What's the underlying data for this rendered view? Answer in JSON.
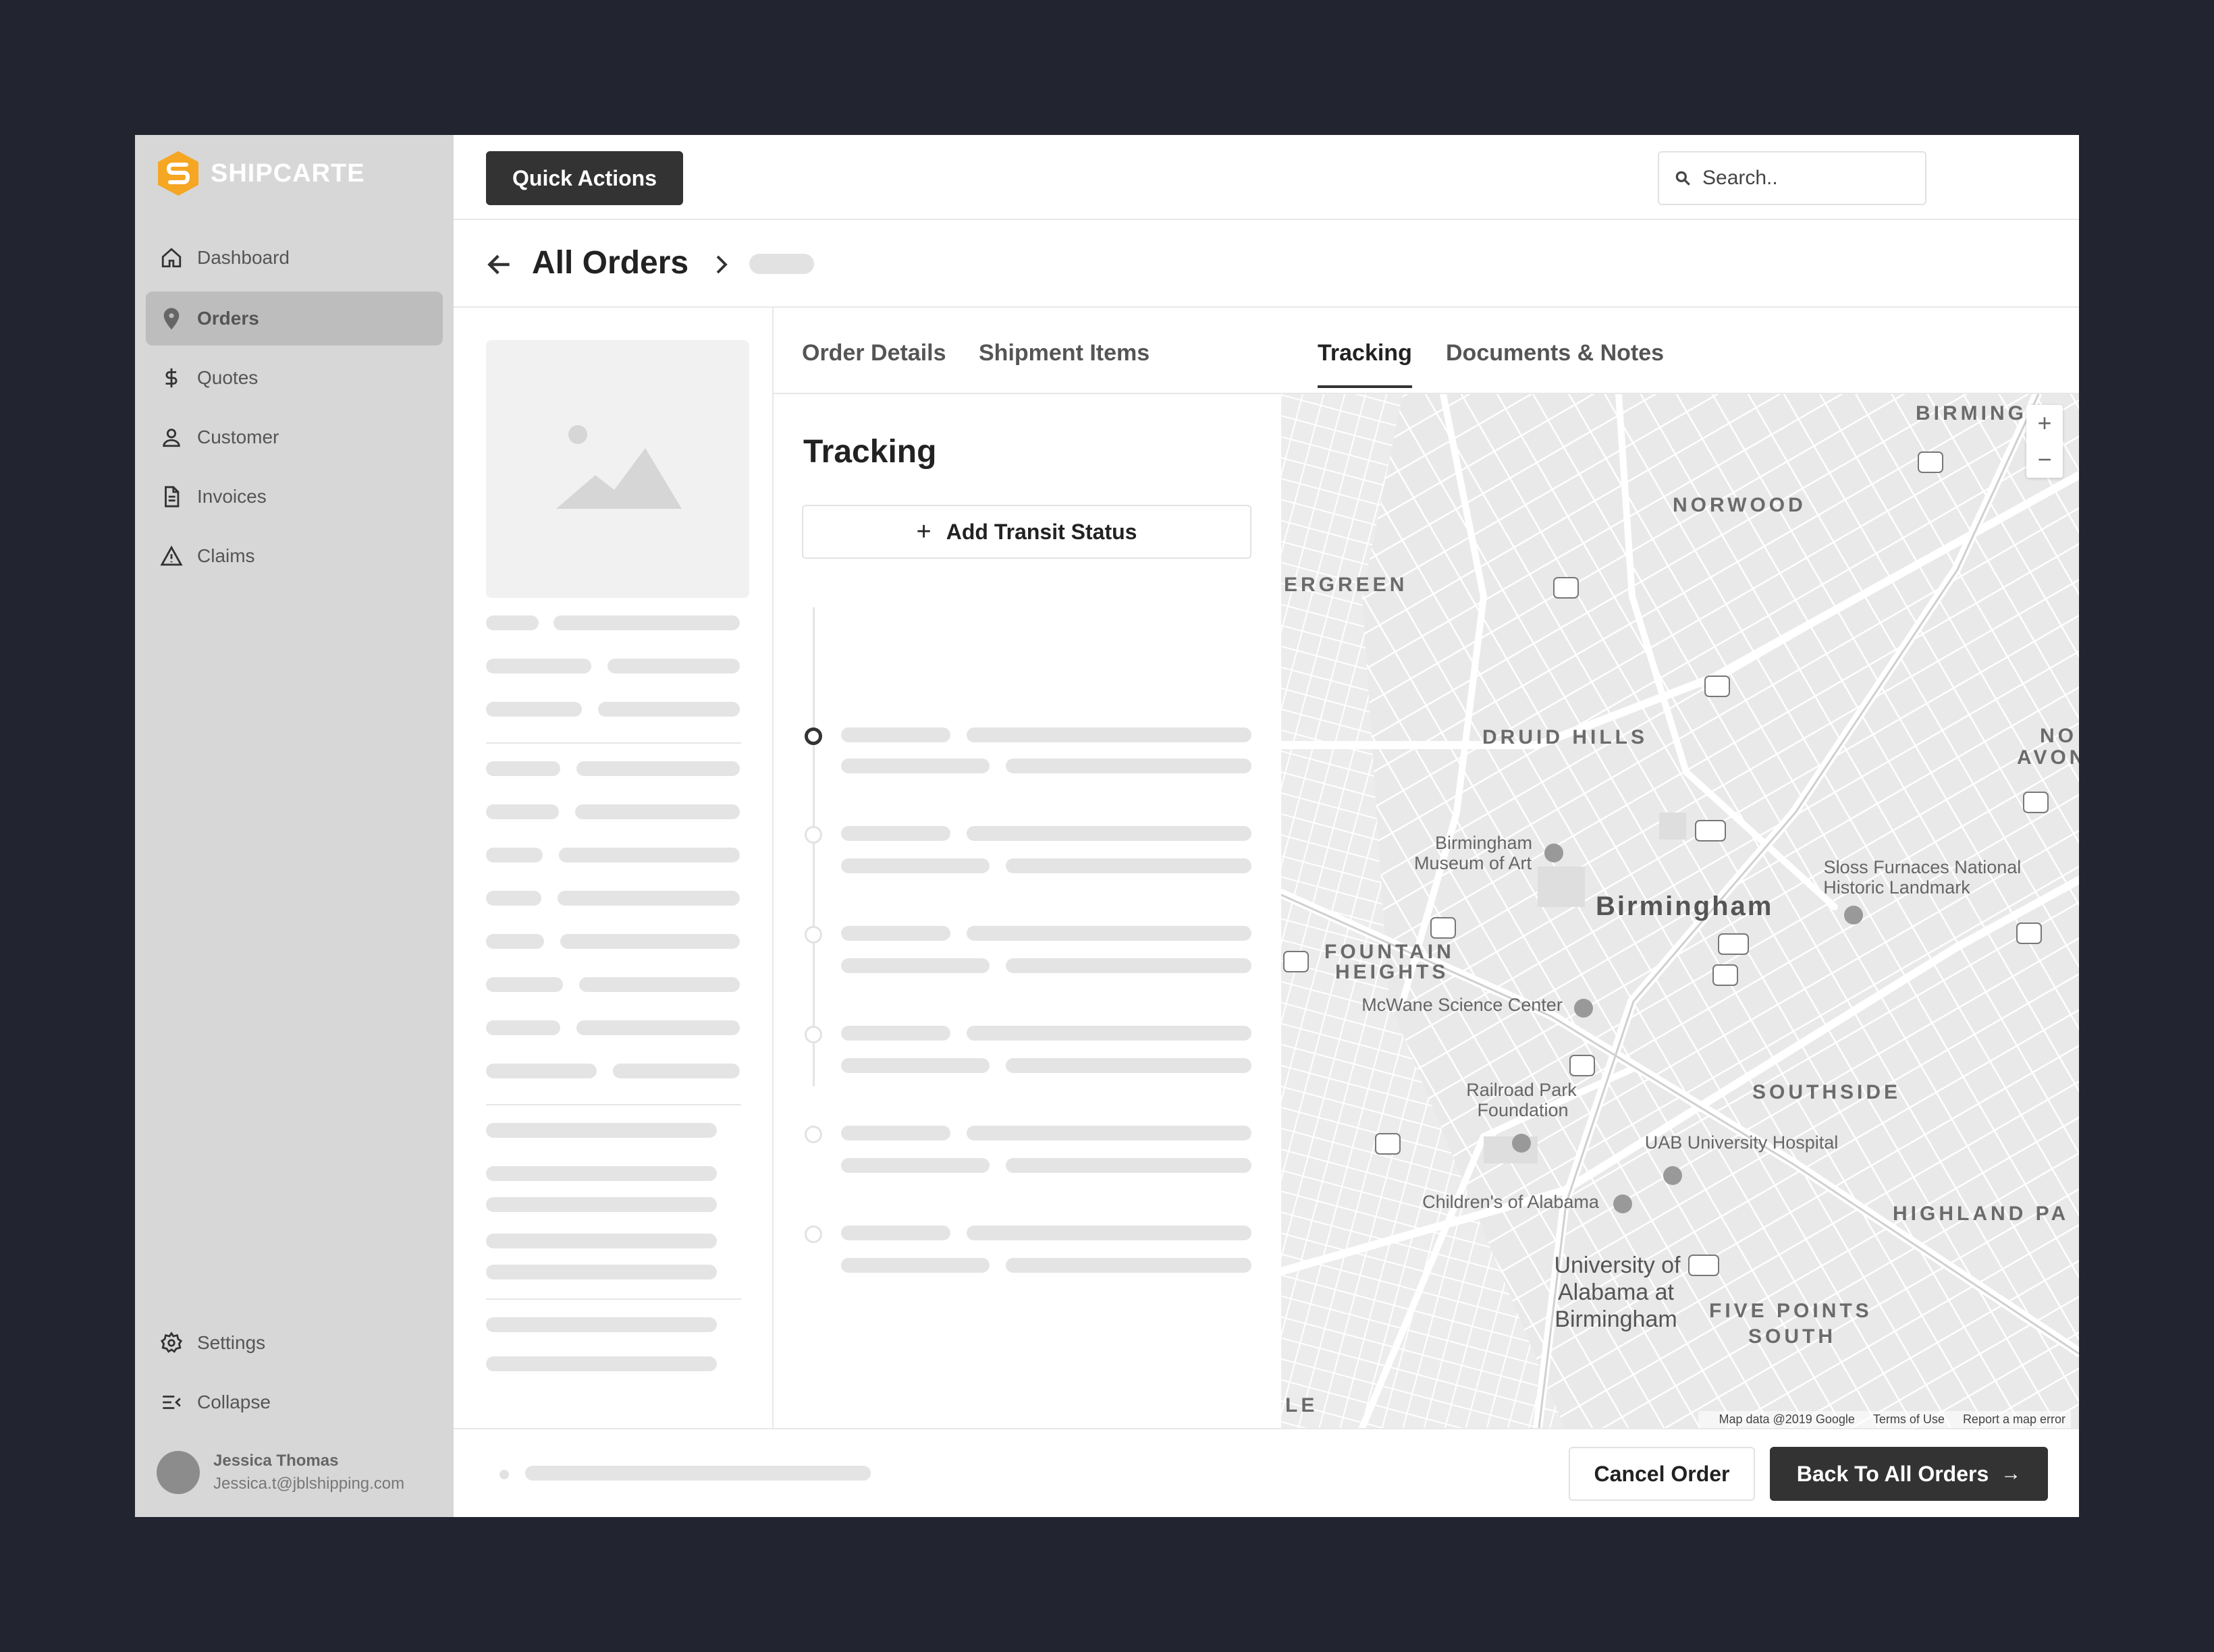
{
  "app": {
    "logo_text": "SHIPCARTE",
    "accent": "#f5a623"
  },
  "sidebar": {
    "items": [
      {
        "label": "Dashboard",
        "icon": "home-icon"
      },
      {
        "label": "Orders",
        "icon": "map-pin-icon"
      },
      {
        "label": "Quotes",
        "icon": "dollar-icon"
      },
      {
        "label": "Customer",
        "icon": "user-icon"
      },
      {
        "label": "Invoices",
        "icon": "document-icon"
      },
      {
        "label": "Claims",
        "icon": "warning-icon"
      }
    ],
    "bottom": [
      {
        "label": "Settings",
        "icon": "gear-icon"
      },
      {
        "label": "Collapse",
        "icon": "collapse-icon"
      }
    ],
    "user": {
      "name": "Jessica Thomas",
      "email": "Jessica.t@jblshipping.com"
    }
  },
  "topbar": {
    "quick_actions": "Quick Actions",
    "search_placeholder": "Search.."
  },
  "header": {
    "title": "All Orders"
  },
  "tabs": [
    {
      "label": "Order Details"
    },
    {
      "label": "Shipment Items"
    },
    {
      "label": "Tracking"
    },
    {
      "label": "Documents & Notes"
    }
  ],
  "tracking": {
    "title": "Tracking",
    "add_label": "Add Transit Status"
  },
  "map": {
    "labels": {
      "birmingham": "Birmingham",
      "norwood": "NORWOOD",
      "druid_hills": "DRUID HILLS",
      "fountain_heights": "FOUNTAIN",
      "fountain_heights_2": "HEIGHTS",
      "southside": "SOUTHSIDE",
      "highland": "HIGHLAND PA",
      "five_points": "FIVE POINTS",
      "five_points_2": "SOUTH",
      "museum": "Birmingham",
      "museum_2": "Museum of Art",
      "sloss": "Sloss Furnaces National",
      "sloss_2": "Historic Landmark",
      "mcwane": "McWane Science Center",
      "railroad": "Railroad Park",
      "railroad_2": "Foundation",
      "uab_hospital": "UAB University Hospital",
      "childrens": "Children's of Alabama",
      "uab": "University of",
      "uab_2": "Alabama at",
      "uab_3": "Birmingham",
      "ergreen": "ERGREEN",
      "birming_top": "BIRMING",
      "no_avon": "NO",
      "no_avon_2": "AVON",
      "le": "LE"
    },
    "footer": {
      "data": "Map data @2019 Google",
      "terms": "Terms of Use",
      "report": "Report a map error"
    },
    "zoom_in": "+",
    "zoom_out": "−"
  },
  "footer": {
    "cancel": "Cancel Order",
    "back": "Back To All Orders"
  }
}
